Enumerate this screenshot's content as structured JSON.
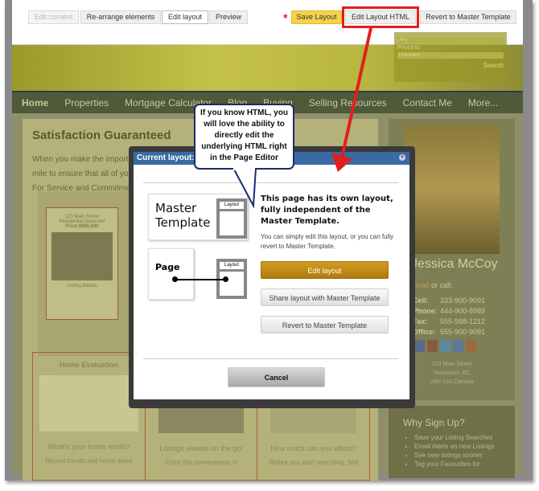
{
  "toolbar": {
    "tabs": [
      "Edit content",
      "Re-arrange elements",
      "Edit layout",
      "Preview"
    ],
    "active_tab": "Edit layout",
    "unsaved_marker": "*",
    "save": "Save Layout",
    "edit_html": "Edit Layout HTML",
    "revert": "Revert to Master Template"
  },
  "search": {
    "type_value": "Any",
    "priced_to_label": "Priced to:",
    "priced_to_value": "Unlimited",
    "button": "Search"
  },
  "nav": [
    "Home",
    "Properties",
    "Mortgage Calculator",
    "Blog",
    "Buying",
    "Selling Resources",
    "Contact Me",
    "More..."
  ],
  "main": {
    "title": "Satisfaction Guaranteed",
    "intro": [
      "When you make the importa",
      "mile to ensure that all of yo",
      "For Service and Commitmen"
    ],
    "map_popup": {
      "address": "123 Main Street",
      "type": "Residential Detached",
      "price": "Price $985,000",
      "link": "Listing Details"
    },
    "cards": [
      {
        "title": "Home Evaluation",
        "caption": "What's your home worth?",
        "desc": "Recent trends and home sales"
      },
      {
        "title": "",
        "caption": "Listings viewed on the go!",
        "desc": "Enjoy the convenience of"
      },
      {
        "title": "",
        "caption": "How much can you afford?",
        "desc": "Before you start searching, find"
      }
    ]
  },
  "agent": {
    "name": "Jessica McCoy",
    "contact_prompt_link": "Email",
    "contact_prompt": "or call:",
    "phones": [
      {
        "label": "Cell:",
        "value": "333-900-9091"
      },
      {
        "label": "Phone:",
        "value": "444-900-8989"
      },
      {
        "label": "Fax:",
        "value": "555-998-1212"
      },
      {
        "label": "Office:",
        "value": "555-900-9091"
      }
    ],
    "social": [
      "facebook-icon",
      "google-icon",
      "twitter-icon",
      "linkedin-icon",
      "youtube-icon"
    ],
    "address": [
      "123 Main Street",
      "Vancouver, BC",
      "V6H 1S4 Canada"
    ]
  },
  "signup": {
    "title": "Why Sign Up?",
    "items": [
      "Save your Listing Searches",
      "Email Alerts on new Listings",
      "See new listings sooner",
      "Tag your Favourites for"
    ]
  },
  "callout": "If you know HTML, you will love the ability to directly edit the underlying HTML right in the Page Editor",
  "modal": {
    "title": "Current layout:",
    "master_label": "Master Template",
    "page_label": "Page",
    "layout_label": "Layout",
    "heading": "This page has its own layout, fully independent of the Master Template.",
    "desc": "You can simply edit this layout, or you can fully revert to Master Template.",
    "edit": "Edit layout",
    "share": "Share layout with Master Template",
    "revert": "Revert to Master Template",
    "cancel": "Cancel"
  },
  "colors": {
    "accent": "#c08a14",
    "highlight": "#e0201e",
    "save": "#f5d24a",
    "modal_header": "#3a6aa3"
  }
}
